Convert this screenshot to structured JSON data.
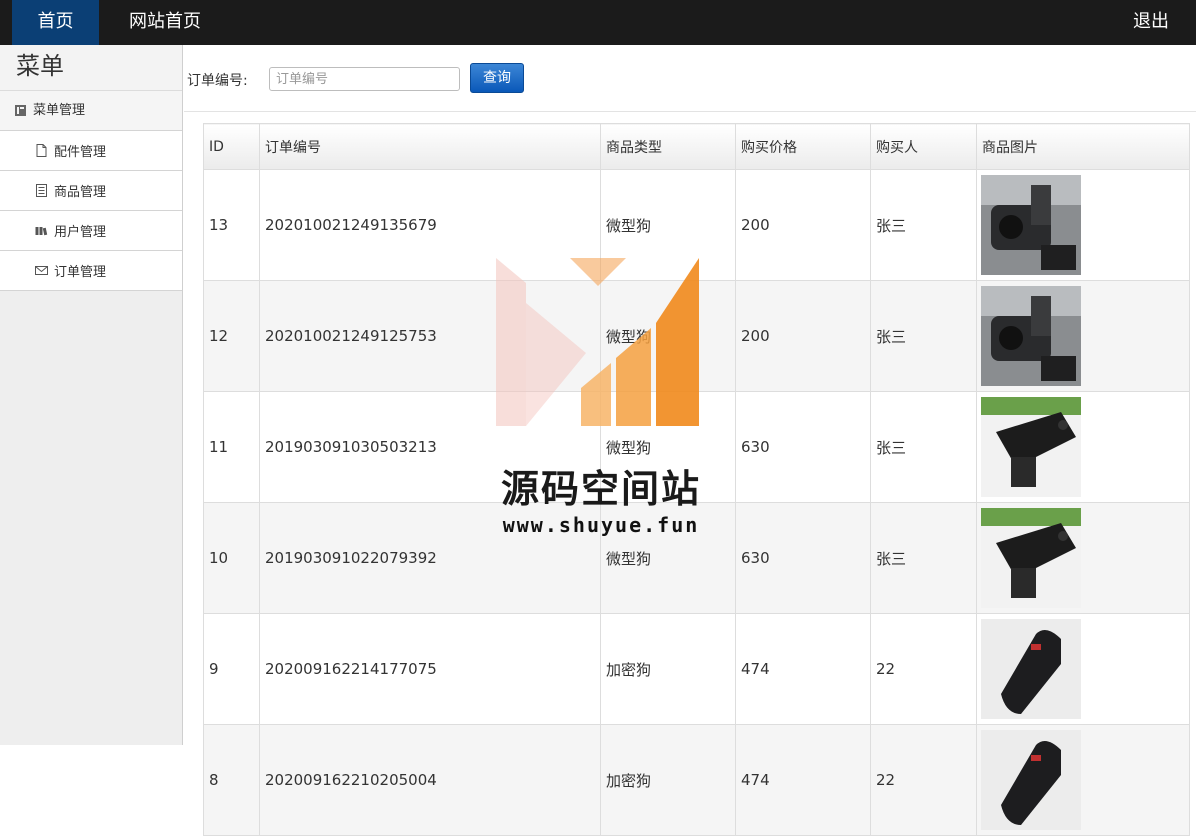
{
  "nav": {
    "home": "首页",
    "site_home": "网站首页",
    "logout": "退出"
  },
  "sidebar": {
    "title": "菜单",
    "group": {
      "label": "菜单管理",
      "icon": "book-icon"
    },
    "items": [
      {
        "label": "配件管理",
        "icon": "file-icon"
      },
      {
        "label": "商品管理",
        "icon": "document-list-icon"
      },
      {
        "label": "用户管理",
        "icon": "books-icon"
      },
      {
        "label": "订单管理",
        "icon": "envelope-icon"
      }
    ]
  },
  "search": {
    "label": "订单编号:",
    "placeholder": "订单编号",
    "value": "",
    "button": "查询"
  },
  "table": {
    "headers": [
      "ID",
      "订单编号",
      "商品类型",
      "购买价格",
      "购买人",
      "商品图片"
    ],
    "rows": [
      {
        "id": "13",
        "order_no": "202010021249135679",
        "type": "微型狗",
        "price": "200",
        "buyer": "张三",
        "image": "dashcam-on-mount-photo"
      },
      {
        "id": "12",
        "order_no": "202010021249125753",
        "type": "微型狗",
        "price": "200",
        "buyer": "张三",
        "image": "dashcam-on-mount-photo"
      },
      {
        "id": "11",
        "order_no": "201903091030503213",
        "type": "微型狗",
        "price": "630",
        "buyer": "张三",
        "image": "black-dashcam-photo"
      },
      {
        "id": "10",
        "order_no": "201903091022079392",
        "type": "微型狗",
        "price": "630",
        "buyer": "张三",
        "image": "black-dashcam-photo"
      },
      {
        "id": "9",
        "order_no": "202009162214177075",
        "type": "加密狗",
        "price": "474",
        "buyer": "22",
        "image": "radar-detector-photo"
      },
      {
        "id": "8",
        "order_no": "202009162210205004",
        "type": "加密狗",
        "price": "474",
        "buyer": "22",
        "image": "radar-detector-photo"
      }
    ]
  },
  "watermark": {
    "title": "源码空间站",
    "url": "www.shuyue.fun"
  },
  "colors": {
    "topbar": "#1b1b1b",
    "nav_active": "#0b3f75",
    "button": "#0a58b8",
    "watermark_orange": "#f18a1c"
  }
}
